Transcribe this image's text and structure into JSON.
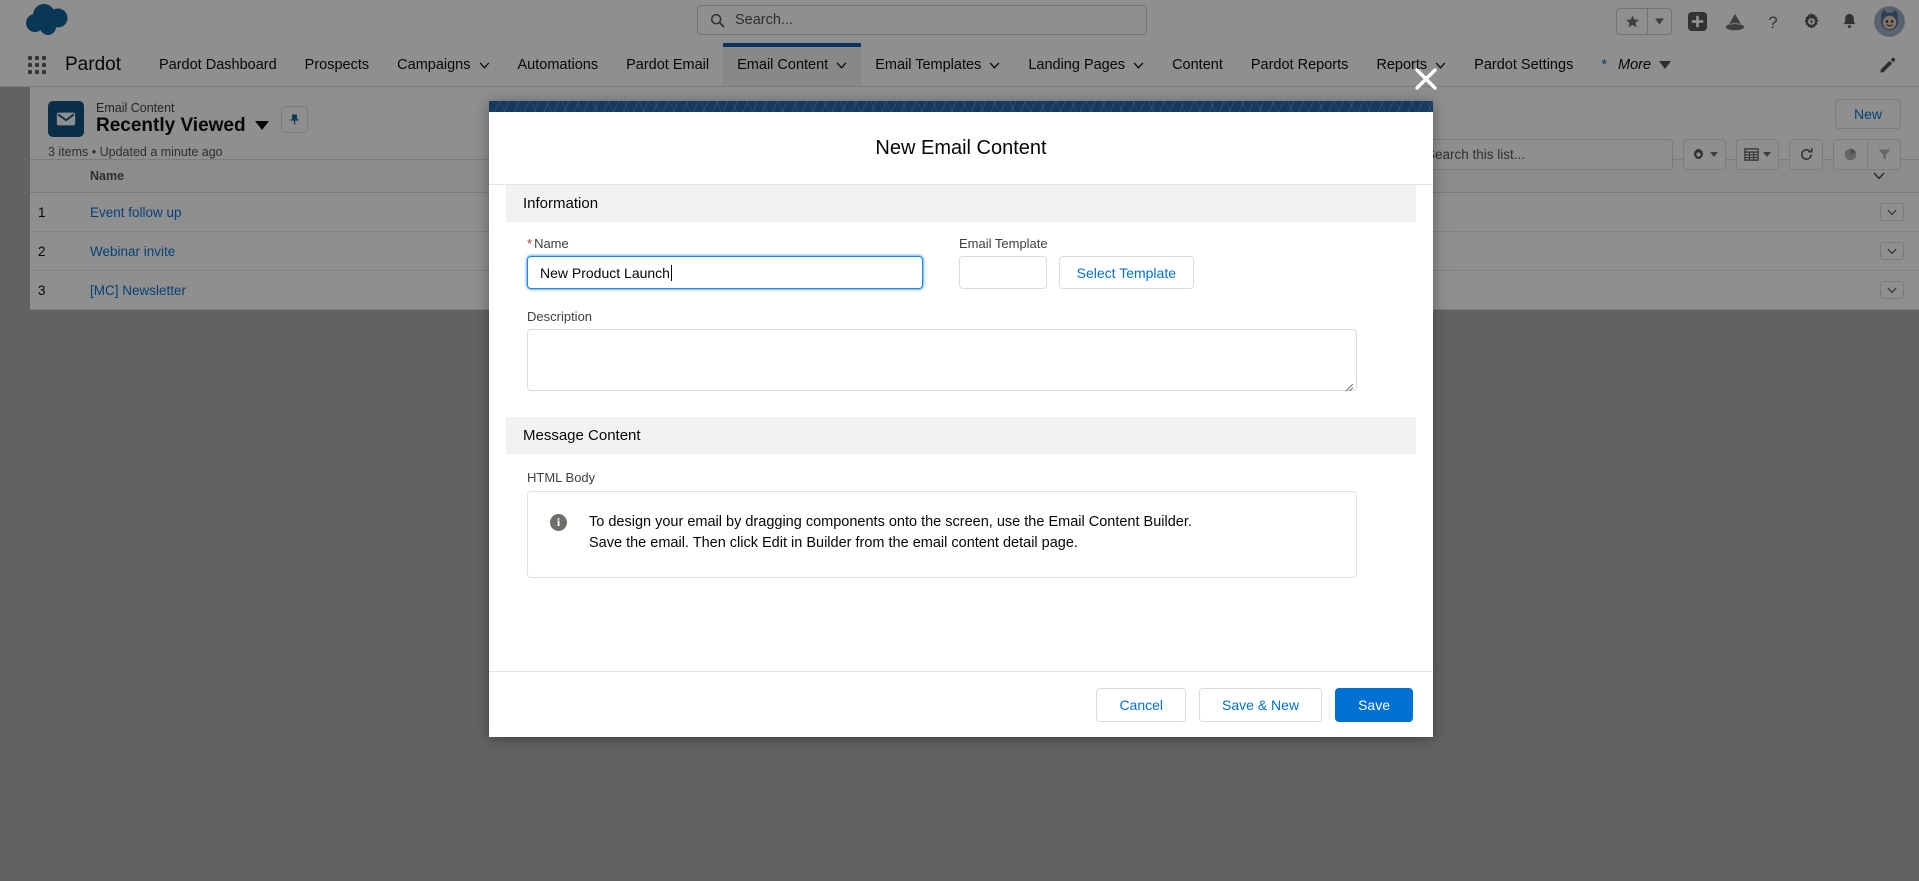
{
  "global_header": {
    "logo_icon": "salesforce-cloud-logo",
    "search": {
      "placeholder": "Search...",
      "value": "",
      "icon": "search-icon"
    },
    "icons": [
      {
        "name": "favorites-star-icon",
        "glyph": "star"
      },
      {
        "name": "favorites-caret-icon",
        "glyph": "caret-down"
      },
      {
        "name": "add-new-icon",
        "glyph": "plus"
      },
      {
        "name": "pardot-app-icon",
        "glyph": "pardot-triangle"
      },
      {
        "name": "help-icon",
        "glyph": "question-mark"
      },
      {
        "name": "setup-gear-icon",
        "glyph": "gear"
      },
      {
        "name": "notifications-bell-icon",
        "glyph": "bell"
      },
      {
        "name": "user-avatar",
        "glyph": "astro-avatar"
      }
    ]
  },
  "app_nav": {
    "waffle_icon": "app-launcher-icon",
    "app_name": "Pardot",
    "items": [
      {
        "label": "Pardot Dashboard",
        "has_caret": false,
        "active": false
      },
      {
        "label": "Prospects",
        "has_caret": false,
        "active": false
      },
      {
        "label": "Campaigns",
        "has_caret": true,
        "active": false
      },
      {
        "label": "Automations",
        "has_caret": false,
        "active": false
      },
      {
        "label": "Pardot Email",
        "has_caret": false,
        "active": false
      },
      {
        "label": "Email Content",
        "has_caret": true,
        "active": true
      },
      {
        "label": "Email Templates",
        "has_caret": true,
        "active": false
      },
      {
        "label": "Landing Pages",
        "has_caret": true,
        "active": false
      },
      {
        "label": "Content",
        "has_caret": false,
        "active": false
      },
      {
        "label": "Pardot Reports",
        "has_caret": false,
        "active": false
      },
      {
        "label": "Reports",
        "has_caret": true,
        "active": false
      },
      {
        "label": "Pardot Settings",
        "has_caret": false,
        "active": false
      }
    ],
    "more": {
      "asterisk": "*",
      "label": "More"
    },
    "edit_icon": "pencil-icon"
  },
  "listview": {
    "object_icon": "email-envelope-icon",
    "eyebrow": "Email Content",
    "name": "Recently Viewed",
    "name_caret_icon": "chevron-down-icon",
    "pin_icon": "pin-icon",
    "meta": "3 items • Updated a minute ago",
    "new_button": "New",
    "search": {
      "placeholder": "Search this list...",
      "value": "",
      "icon": "search-icon"
    },
    "tool_icons": [
      {
        "name": "list-settings-gear-icon",
        "glyph": "gear"
      },
      {
        "name": "display-as-table-icon",
        "glyph": "table"
      },
      {
        "name": "refresh-icon",
        "glyph": "refresh"
      },
      {
        "name": "chart-icon",
        "glyph": "pie-chart"
      },
      {
        "name": "filter-icon",
        "glyph": "funnel"
      }
    ],
    "columns": [
      "",
      "Name",
      ""
    ],
    "rows": [
      {
        "index": "1",
        "name": "Event follow up"
      },
      {
        "index": "2",
        "name": "Webinar invite"
      },
      {
        "index": "3",
        "name": "[MC] Newsletter"
      }
    ],
    "row_action_icon": "row-actions-chevron-icon",
    "header_action_icon": "column-chooser-chevron-icon"
  },
  "modal": {
    "close_icon": "close-icon",
    "title": "New Email Content",
    "sections": {
      "information": {
        "heading": "Information",
        "name_field": {
          "label": "Name",
          "required_marker": "*",
          "value": "New Product Launch",
          "placeholder": ""
        },
        "template_field": {
          "label": "Email Template",
          "value": "",
          "placeholder": "",
          "button": "Select Template"
        },
        "description_field": {
          "label": "Description",
          "value": "",
          "placeholder": ""
        }
      },
      "message_content": {
        "heading": "Message Content",
        "html_body_label": "HTML Body",
        "info_icon": "info-icon",
        "info_line1": "To design your email by dragging components onto the screen, use the Email Content Builder.",
        "info_line2": "Save the email. Then click Edit in Builder from the email content detail page."
      }
    },
    "footer": {
      "cancel": "Cancel",
      "save_new": "Save & New",
      "save": "Save"
    }
  },
  "colors": {
    "brand_blue": "#0070d2",
    "nav_active_blue": "#0b5cab",
    "object_icon_blue": "#08507d",
    "modal_band_navy": "#17395f",
    "required_red": "#c23934"
  }
}
